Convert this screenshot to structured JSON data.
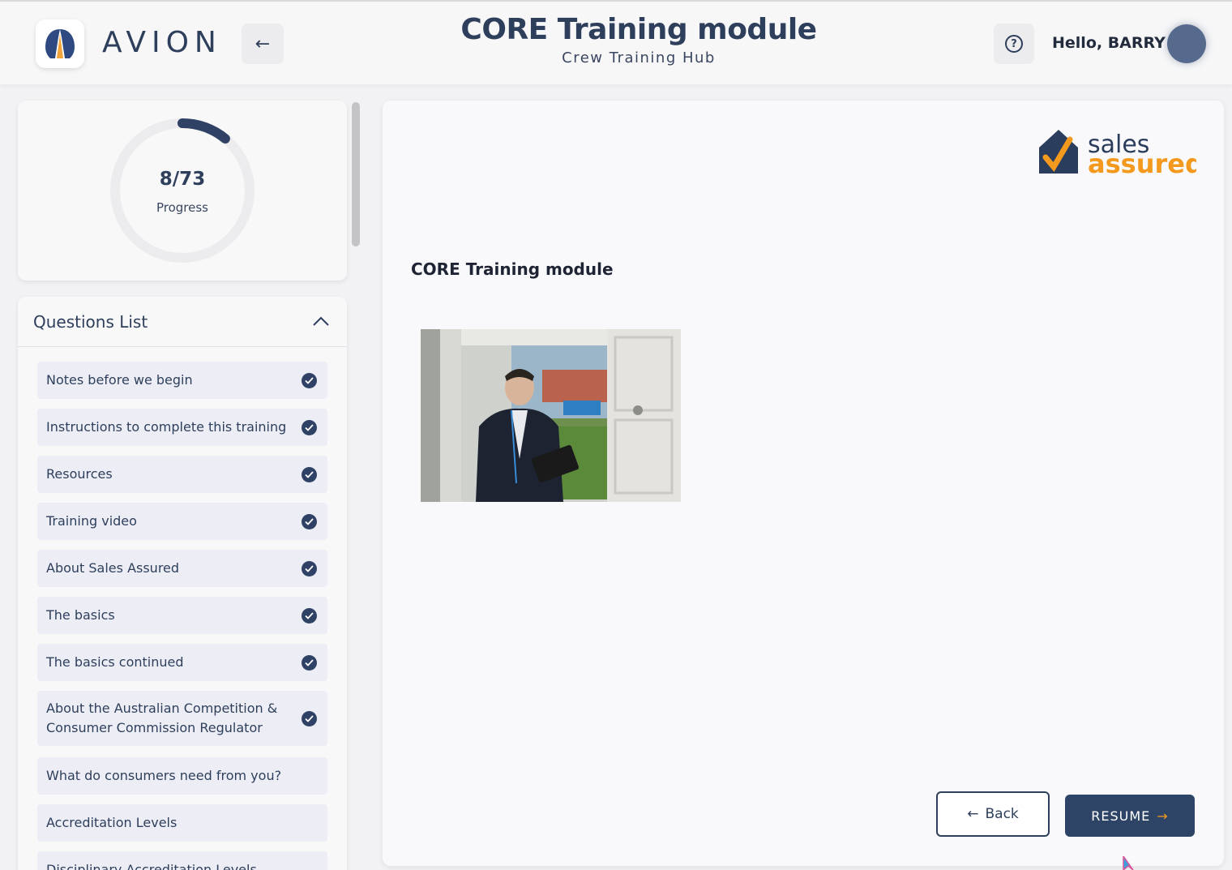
{
  "header": {
    "brand": "AVION",
    "back_icon": "←",
    "title": "CORE Training module",
    "subtitle": "Crew Training Hub",
    "help_icon": "?",
    "greeting": "Hello, BARRY"
  },
  "progress": {
    "completed": 8,
    "total": 73,
    "value_text": "8/73",
    "label": "Progress",
    "fraction": 0.11
  },
  "questions": {
    "title": "Questions List",
    "items": [
      {
        "label": "Notes before we begin",
        "done": true
      },
      {
        "label": "Instructions to complete this training",
        "done": true
      },
      {
        "label": "Resources",
        "done": true
      },
      {
        "label": "Training video",
        "done": true
      },
      {
        "label": "About Sales Assured",
        "done": true
      },
      {
        "label": "The basics",
        "done": true
      },
      {
        "label": "The basics continued",
        "done": true
      },
      {
        "label": "About the Australian Competition & Consumer Commission Regulator",
        "done": true
      },
      {
        "label": "What do consumers need from you?",
        "done": false
      },
      {
        "label": "Accreditation Levels",
        "done": false
      },
      {
        "label": "Disciplinary Accreditation Levels",
        "done": false
      }
    ]
  },
  "main": {
    "logo_text_top": "sales",
    "logo_text_bottom": "assured",
    "section_title": "CORE Training module",
    "back_button": "Back",
    "back_icon": "←",
    "resume_button": "RESUME",
    "resume_icon": "→"
  },
  "colors": {
    "primary": "#2e4467",
    "accent_orange": "#f39a1e",
    "item_bg": "#edeef5"
  }
}
